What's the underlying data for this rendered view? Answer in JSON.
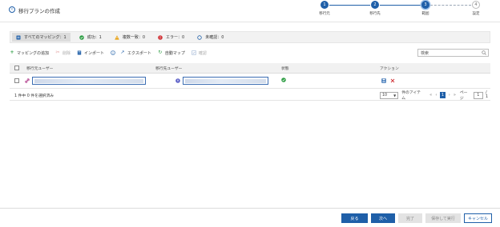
{
  "header": {
    "title": "移行プランの作成",
    "steps": [
      {
        "num": "1",
        "label": "移行元",
        "state": "done"
      },
      {
        "num": "2",
        "label": "移行先",
        "state": "done"
      },
      {
        "num": "3",
        "label": "範囲",
        "state": "current"
      },
      {
        "num": "4",
        "label": "設定",
        "state": "pending"
      }
    ]
  },
  "filters": [
    {
      "label": "すべてのマッピング：1",
      "icon": "list-icon"
    },
    {
      "label": "成功：1",
      "icon": "check-circle-icon"
    },
    {
      "label": "複数一致：0",
      "icon": "warning-icon"
    },
    {
      "label": "エラー：0",
      "icon": "error-icon"
    },
    {
      "label": "未確認：0",
      "icon": "unverified-icon"
    }
  ],
  "toolbar": {
    "add": "マッピングの追加",
    "delete": "削除",
    "import": "インポート",
    "export": "エクスポート",
    "automap": "自動マップ",
    "confirm": "確認",
    "search_placeholder": "検索"
  },
  "table": {
    "columns": [
      "移行元ユーザー",
      "移行先ユーザー",
      "状態",
      "アクション"
    ],
    "rows": [
      {
        "source_user": "",
        "target_user": "",
        "status": "success"
      }
    ]
  },
  "pagination": {
    "selection_count": "1 件中 0 件を選択済み",
    "page_size": "10",
    "items_label": "件のアイテム",
    "current_page": "1",
    "page_label": "ページ",
    "page_input": "1",
    "total_pages": "/ 1"
  },
  "footer": {
    "back": "戻る",
    "next": "次へ",
    "finish": "完了",
    "save_run": "保存して実行",
    "cancel": "キャンセル"
  },
  "colors": {
    "accent": "#1f5fa8",
    "success": "#2e9e44",
    "warning": "#e8a317",
    "error": "#d13438"
  }
}
